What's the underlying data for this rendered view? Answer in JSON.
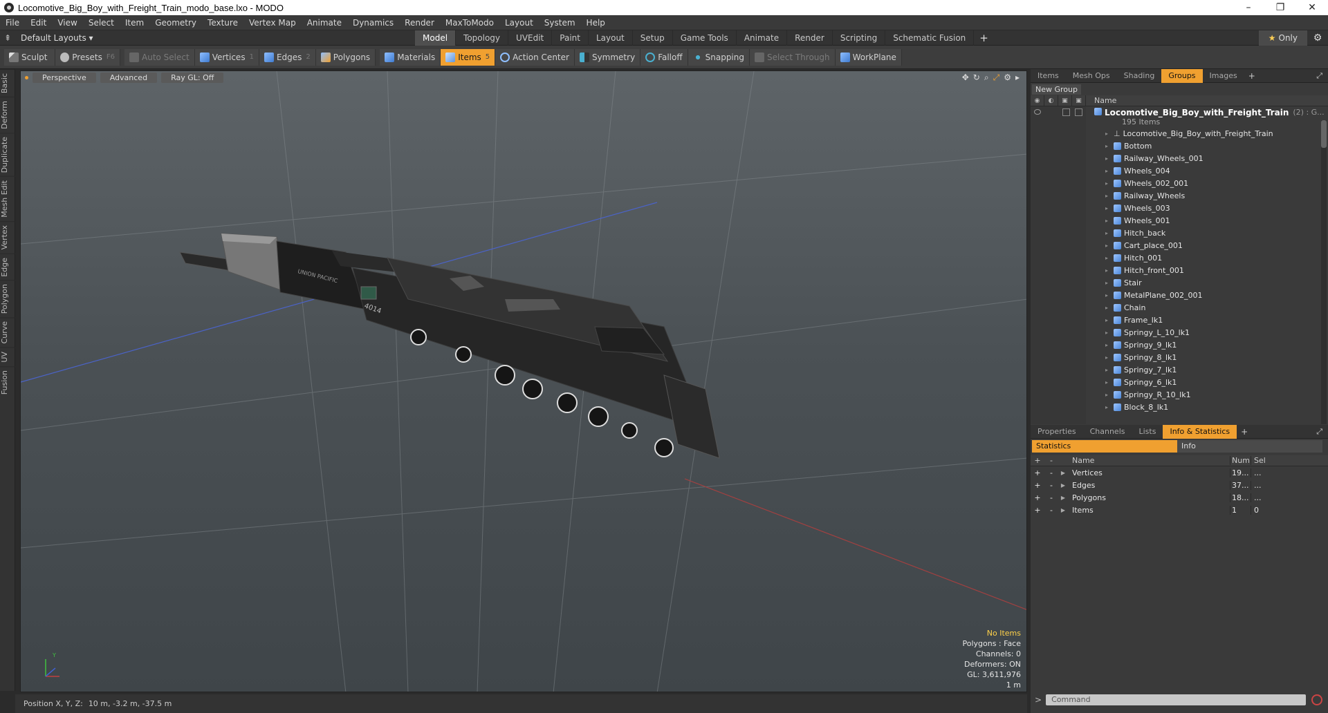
{
  "window": {
    "title": "Locomotive_Big_Boy_with_Freight_Train_modo_base.lxo - MODO",
    "minimize": "–",
    "maximize": "❐",
    "close": "✕"
  },
  "menu": [
    "File",
    "Edit",
    "View",
    "Select",
    "Item",
    "Geometry",
    "Texture",
    "Vertex Map",
    "Animate",
    "Dynamics",
    "Render",
    "MaxToModo",
    "Layout",
    "System",
    "Help"
  ],
  "layout_tabs": {
    "layout_selector": "Default Layouts ▾",
    "tabs": [
      "Model",
      "Topology",
      "UVEdit",
      "Paint",
      "Layout",
      "Setup",
      "Game Tools",
      "Animate",
      "Render",
      "Scripting",
      "Schematic Fusion"
    ],
    "active": "Model",
    "plus": "+",
    "only_star": "★",
    "only_label": "Only",
    "gear": "⚙"
  },
  "toolbar": {
    "sculpt": "Sculpt",
    "presets": "Presets",
    "presets_key": "F6",
    "auto_select": "Auto Select",
    "vertices": "Vertices",
    "vertices_count": "1",
    "edges": "Edges",
    "edges_count": "2",
    "polygons": "Polygons",
    "materials": "Materials",
    "items": "Items",
    "items_count": "5",
    "action_center": "Action Center",
    "symmetry": "Symmetry",
    "falloff": "Falloff",
    "snapping": "Snapping",
    "select_through": "Select Through",
    "workplane": "WorkPlane"
  },
  "left_tabs": [
    "Basic",
    "Deform",
    "Duplicate",
    "Mesh Edit",
    "Vertex",
    "Edge",
    "Polygon",
    "Curve",
    "UV",
    "Fusion"
  ],
  "viewport": {
    "perspective": "Perspective",
    "advanced": "Advanced",
    "raygl": "Ray GL: Off",
    "info": {
      "selection": "No Items",
      "polygons": "Polygons : Face",
      "channels": "Channels: 0",
      "deformers": "Deformers: ON",
      "gl": "GL: 3,611,976",
      "scale": "1 m"
    },
    "axis_y": "Y",
    "tender_text": "UNION PACIFIC",
    "number_text": "4014"
  },
  "status": {
    "label": "Position X, Y, Z:",
    "value": "10 m, -3.2 m, -37.5 m"
  },
  "upper_panel": {
    "tabs": [
      "Items",
      "Mesh Ops",
      "Shading",
      "Groups",
      "Images"
    ],
    "active": "Groups",
    "new_group": "New Group",
    "name_header": "Name",
    "root": {
      "name": "Locomotive_Big_Boy_with_Freight_Train",
      "count": "(2) : G...",
      "sub": "195 Items"
    },
    "items": [
      "Locomotive_Big_Boy_with_Freight_Train",
      "Bottom",
      "Railway_Wheels_001",
      "Wheels_004",
      "Wheels_002_001",
      "Railway_Wheels",
      "Wheels_003",
      "Wheels_001",
      "Hitch_back",
      "Cart_place_001",
      "Hitch_001",
      "Hitch_front_001",
      "Stair",
      "MetalPlane_002_001",
      "Chain",
      "Frame_lk1",
      "Springy_L_10_lk1",
      "Springy_9_lk1",
      "Springy_8_lk1",
      "Springy_7_lk1",
      "Springy_6_lk1",
      "Springy_R_10_lk1",
      "Block_8_lk1"
    ]
  },
  "lower_panel": {
    "tabs": [
      "Properties",
      "Channels",
      "Lists",
      "Info & Statistics"
    ],
    "active": "Info & Statistics",
    "subtabs": [
      "Statistics",
      "Info"
    ],
    "headers": {
      "name": "Name",
      "num": "Num",
      "sel": "Sel"
    },
    "rows": [
      {
        "name": "Vertices",
        "num": "19...",
        "sel": "..."
      },
      {
        "name": "Edges",
        "num": "37...",
        "sel": "..."
      },
      {
        "name": "Polygons",
        "num": "18...",
        "sel": "..."
      },
      {
        "name": "Items",
        "num": "1",
        "sel": "0"
      }
    ]
  },
  "command": {
    "prompt": ">",
    "placeholder": "Command"
  }
}
